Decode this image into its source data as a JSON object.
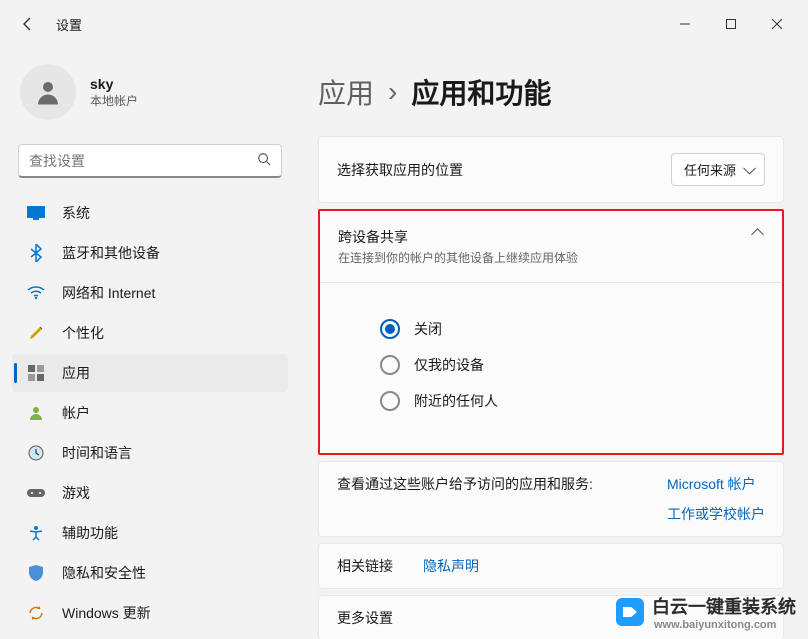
{
  "window": {
    "title": "设置"
  },
  "user": {
    "name": "sky",
    "sub": "本地帐户"
  },
  "search": {
    "placeholder": "查找设置"
  },
  "nav": {
    "system": "系统",
    "bluetooth": "蓝牙和其他设备",
    "network": "网络和 Internet",
    "personalization": "个性化",
    "apps": "应用",
    "accounts": "帐户",
    "time": "时间和语言",
    "gaming": "游戏",
    "accessibility": "辅助功能",
    "privacy": "隐私和安全性",
    "update": "Windows 更新"
  },
  "breadcrumb": {
    "parent": "应用",
    "current": "应用和功能"
  },
  "source": {
    "label": "选择获取应用的位置",
    "value": "任何来源"
  },
  "cross_device": {
    "title": "跨设备共享",
    "sub": "在连接到你的帐户的其他设备上继续应用体验",
    "options": {
      "off": "关闭",
      "mine": "仅我的设备",
      "anyone": "附近的任何人"
    },
    "selected": "off"
  },
  "accounts_access": {
    "label": "查看通过这些账户给予访问的应用和服务:",
    "links": {
      "ms": "Microsoft 帐户",
      "work": "工作或学校帐户"
    }
  },
  "related": {
    "label": "相关链接",
    "privacy": "隐私声明"
  },
  "more": {
    "label": "更多设置"
  },
  "watermark": {
    "brand": "白云一键重装系统",
    "url": "www.baiyunxitong.com"
  }
}
